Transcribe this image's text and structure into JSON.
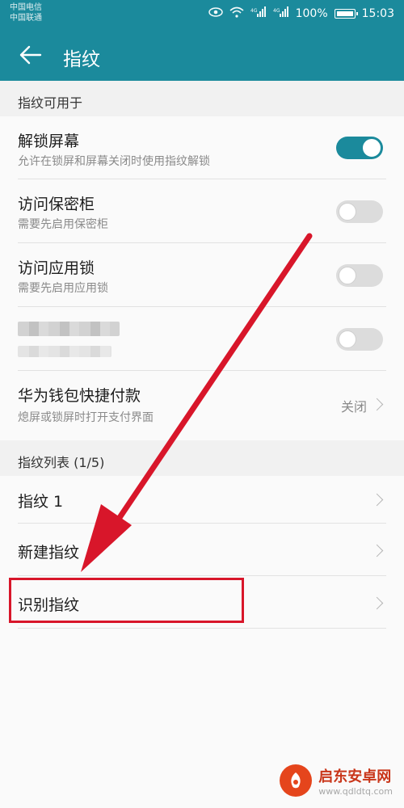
{
  "status_bar": {
    "carrier_1": "中国电信",
    "carrier_2": "中国联通",
    "battery": "100%",
    "time": "15:03",
    "icons": [
      "eye-icon",
      "wifi-icon",
      "signal-4g-icon",
      "signal-4g-icon",
      "battery-icon"
    ]
  },
  "app_bar": {
    "title": "指纹",
    "back_icon": "arrow-left-icon"
  },
  "section_usage": {
    "header": "指纹可用于",
    "items": [
      {
        "title": "解锁屏幕",
        "subtitle": "允许在锁屏和屏幕关闭时使用指纹解锁",
        "toggle": true
      },
      {
        "title": "访问保密柜",
        "subtitle": "需要先启用保密柜",
        "toggle": false
      },
      {
        "title": "访问应用锁",
        "subtitle": "需要先启用应用锁",
        "toggle": false
      },
      {
        "title": "",
        "subtitle": "",
        "toggle": false,
        "blurred": true
      },
      {
        "title": "华为钱包快捷付款",
        "subtitle": "熄屏或锁屏时打开支付界面",
        "value": "关闭"
      }
    ]
  },
  "section_list": {
    "header": "指纹列表 (1/5)",
    "items": [
      {
        "title": "指纹 1"
      },
      {
        "title": "新建指纹"
      },
      {
        "title": "识别指纹"
      }
    ]
  },
  "watermark": {
    "name": "启东安卓网",
    "url": "www.qdldtq.com"
  },
  "colors": {
    "accent": "#1b8a9c",
    "annotation_red": "#d8162a"
  }
}
